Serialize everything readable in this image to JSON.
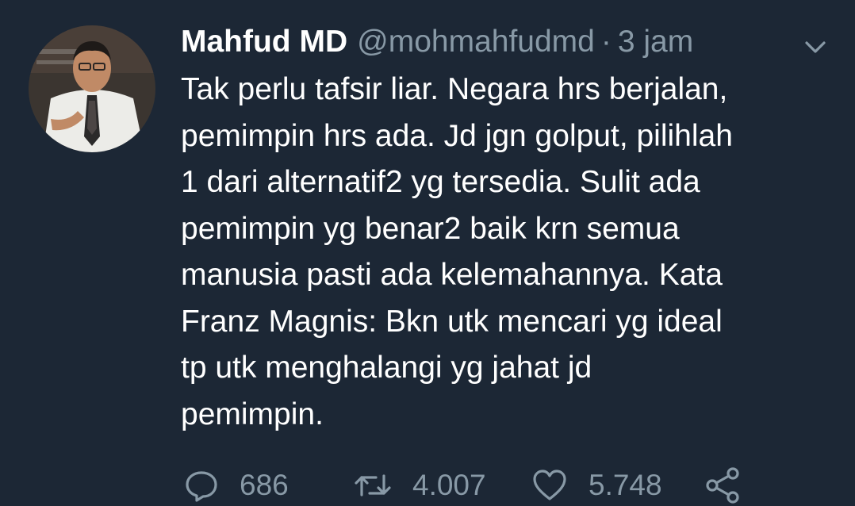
{
  "tweet": {
    "author_name": "Mahfud MD",
    "handle": "@mohmahfudmd",
    "separator": "·",
    "time": "3 jam",
    "text_lines": [
      "Tak perlu tafsir liar. Negara hrs berjalan,",
      "pemimpin hrs ada. Jd jgn golput, pilihlah",
      "1 dari alternatif2 yg tersedia. Sulit ada",
      "pemimpin yg benar2 baik krn semua",
      "manusia pasti ada kelemahannya. Kata",
      "Franz Magnis: Bkn utk mencari yg ideal",
      "tp utk menghalangi yg jahat jd",
      "pemimpin."
    ],
    "reply_count": "686",
    "retweet_count": "4.007",
    "like_count": "5.748"
  },
  "icons": {
    "menu": "chevron-down-icon",
    "reply": "reply-icon",
    "retweet": "retweet-icon",
    "like": "heart-icon",
    "share": "share-icon"
  },
  "colors": {
    "background": "#1c2735",
    "text": "#ffffff",
    "secondary": "#8899a6"
  }
}
